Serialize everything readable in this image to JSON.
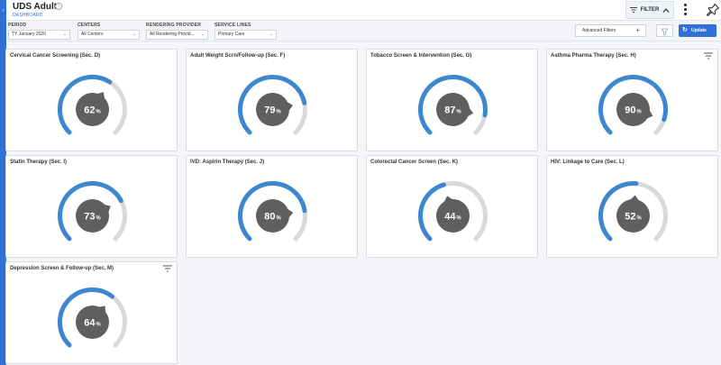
{
  "header": {
    "title": "UDS Adult",
    "subtitle": "DASHBOARD",
    "filter_label": "FILTER"
  },
  "filters": {
    "period": {
      "label": "PERIOD",
      "value": "TY January 2020"
    },
    "centers": {
      "label": "CENTERS",
      "value": "All Centers"
    },
    "rendering_provider": {
      "label": "RENDERING PROVIDER",
      "value": "All Rendering Provid..."
    },
    "service_lines": {
      "label": "SERVICE LINES",
      "value": "Primary Care"
    },
    "advanced_label": "Advanced Filters",
    "update_label": "Update"
  },
  "colors": {
    "accent": "#2f6fd6",
    "gauge_fill": "#3d87cf",
    "gauge_track": "#d9d9d9",
    "gauge_center": "#5f5f5f"
  },
  "cards": [
    {
      "title": "Cervical Cancer Screening (Sec. D)",
      "value": 62,
      "has_filter": false
    },
    {
      "title": "Adult Weight Scrn/Follow-up (Sec. F)",
      "value": 79,
      "has_filter": false
    },
    {
      "title": "Tobacco Screen & Intervention (Sec. G)",
      "value": 87,
      "has_filter": false
    },
    {
      "title": "Asthma Pharma Therapy (Sec. H)",
      "value": 90,
      "has_filter": true
    },
    {
      "title": "Statin Therapy (Sec. I)",
      "value": 73,
      "has_filter": false
    },
    {
      "title": "IVD: Aspirin Therapy (Sec. J)",
      "value": 80,
      "has_filter": false
    },
    {
      "title": "Colorectal Cancer Screen (Sec. K)",
      "value": 44,
      "has_filter": false
    },
    {
      "title": "HIV: Linkage to Care (Sec. L)",
      "value": 52,
      "has_filter": false
    },
    {
      "title": "Depression Screen & Follow-up (Sec. M)",
      "value": 64,
      "has_filter": true
    }
  ],
  "percent_sign": "%"
}
